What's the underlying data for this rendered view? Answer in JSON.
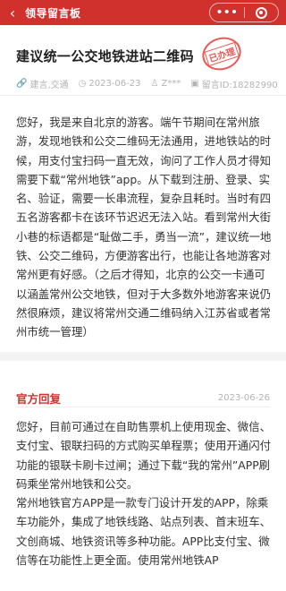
{
  "header": {
    "back_icon": "‹",
    "title": "领导留言板",
    "more_icon": "•••"
  },
  "article": {
    "title": "建议统一公交地铁进站二维码",
    "status_stamp": "已办理",
    "tags": "建言,交通",
    "date": "2023-06-23",
    "author": "Z***",
    "message_id": "留言ID:18282990",
    "body": "您好，我是来自北京的游客。端午节期间在常州旅游，发现地铁和公交二维码无法通用，进地铁站的时候，用支付宝扫码一直无效，询问了工作人员才得知需要下载“常州地铁”app。从下载到注册、登录、实名、验证，需要一长串流程，复杂且耗时。当时有四五名游客都卡在该环节迟迟无法入站。看到常州大街小巷的标语都是“耻做二手，勇当一流”，建议统一地铁、公交二维码，方便游客出行，也能让各地游客对常州更有好感。（之后才得知，北京的公交一卡通可以涵盖常州公交地铁，但对于大多数外地游客来说仍然很麻烦，建议将常州交通二维码纳入江苏省或者常州市统一管理）"
  },
  "reply": {
    "label": "官方回复",
    "date": "2023-06-26",
    "para1": "您好，目前可通过在自助售票机上使用现金、微信、支付宝、银联扫码的方式购买单程票；使用开通闪付功能的银联卡刷卡过闸；通过下载“我的常州”APP刷码乘坐常州地铁和公交。",
    "para2": "常州地铁官方APP是一款专门设计开发的APP，除乘车功能外，集成了地铁线路、站点列表、首末班车、文创商城、地铁资讯等多种功能。APP比支付宝、微信等在功能性上更全面。使用常州地铁AP"
  },
  "colors": {
    "brand_red": "#d0312d",
    "muted_gray": "#b3b3b3"
  }
}
